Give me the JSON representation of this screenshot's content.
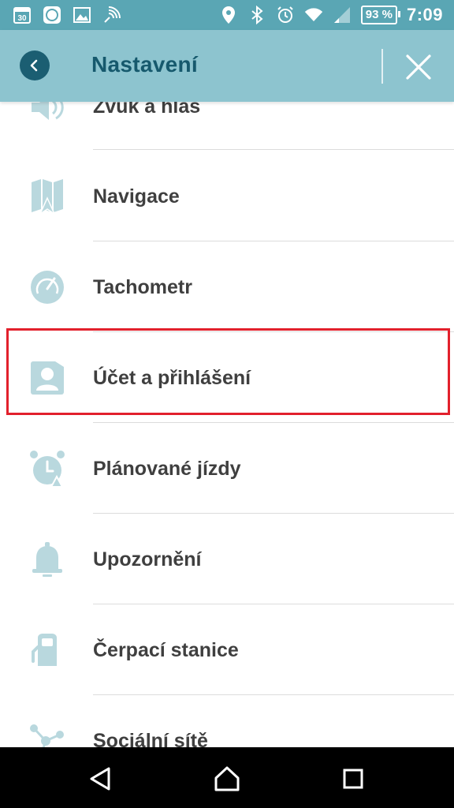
{
  "status_bar": {
    "calendar_day": "30",
    "battery": "93 %",
    "time": "7:09",
    "left_icons": [
      "calendar-icon",
      "mi-app-icon",
      "gallery-icon",
      "broadcast-icon"
    ],
    "right_icons": [
      "location-icon",
      "bluetooth-icon",
      "alarm-icon",
      "wifi-icon",
      "signal-icon"
    ]
  },
  "header": {
    "title": "Nastavení",
    "back_icon": "back-icon",
    "close_icon": "close-icon"
  },
  "menu": {
    "items": [
      {
        "label": "Zvuk a hlas",
        "icon": "speaker-icon"
      },
      {
        "label": "Navigace",
        "icon": "map-icon"
      },
      {
        "label": "Tachometr",
        "icon": "speedometer-icon"
      },
      {
        "label": "Účet a přihlášení",
        "icon": "account-card-icon"
      },
      {
        "label": "Plánované jízdy",
        "icon": "alarm-clock-icon"
      },
      {
        "label": "Upozornění",
        "icon": "bell-icon"
      },
      {
        "label": "Čerpací stanice",
        "icon": "fuel-pump-icon"
      },
      {
        "label": "Sociální sítě",
        "icon": "share-network-icon"
      }
    ]
  },
  "nav_bar": {
    "icons": [
      "back-triangle-icon",
      "home-icon",
      "recents-icon"
    ]
  },
  "colors": {
    "status_bar": "#5aa6b4",
    "header": "#8dc4cf",
    "title": "#16596d",
    "icon": "#b9d8de",
    "highlight": "#e2202c"
  }
}
